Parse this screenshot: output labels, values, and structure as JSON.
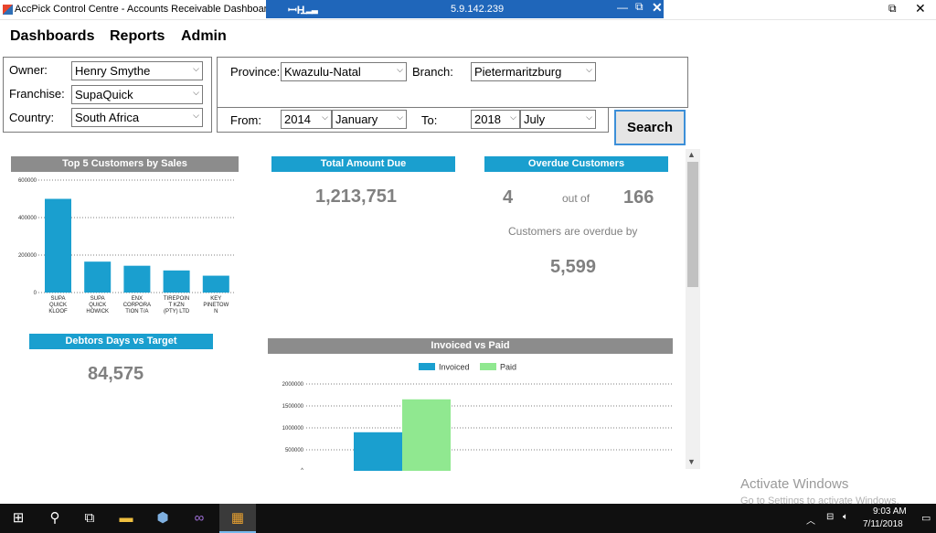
{
  "window": {
    "title": "AccPick Control Centre - Accounts Receivable Dashboard",
    "remote_ip": "5.9.142.239"
  },
  "menu": {
    "dashboards": "Dashboards",
    "reports": "Reports",
    "admin": "Admin"
  },
  "filters": {
    "owner_label": "Owner:",
    "owner_value": "Henry Smythe",
    "franchise_label": "Franchise:",
    "franchise_value": "SupaQuick",
    "country_label": "Country:",
    "country_value": "South Africa",
    "province_label": "Province:",
    "province_value": "Kwazulu-Natal",
    "branch_label": "Branch:",
    "branch_value": "Pietermaritzburg",
    "from_label": "From:",
    "from_year": "2014",
    "from_month": "January",
    "to_label": "To:",
    "to_year": "2018",
    "to_month": "July",
    "search_label": "Search"
  },
  "panels": {
    "top5_title": "Top 5 Customers by Sales",
    "total_due_title": "Total Amount Due",
    "total_due_value": "1,213,751",
    "overdue_title": "Overdue Customers",
    "overdue_count": "4",
    "overdue_out_of": "out of",
    "overdue_total": "166",
    "overdue_by_text": "Customers are overdue by",
    "overdue_by_value": "5,599",
    "debtors_title": "Debtors Days vs Target",
    "debtors_value": "84,575",
    "invoiced_title": "Invoiced vs Paid"
  },
  "chart_data": [
    {
      "type": "bar",
      "title": "Top 5 Customers by Sales",
      "categories": [
        [
          "SUPA",
          "QUICK",
          "KLOOF"
        ],
        [
          "SUPA",
          "QUICK",
          "HOWICK"
        ],
        [
          "ENX",
          "CORPORA",
          "TION T/A"
        ],
        [
          "TIREPOIN",
          "T KZN",
          "(PTY) LTD"
        ],
        [
          "KEY",
          "PINETOW",
          "N"
        ]
      ],
      "values": [
        500000,
        165000,
        143000,
        118000,
        90000
      ],
      "y_ticks": [
        "600000",
        "400000",
        "200000",
        "0"
      ],
      "ylim": [
        0,
        600000
      ],
      "grid": true,
      "color": "#1a9fcf"
    },
    {
      "type": "bar",
      "title": "Invoiced vs Paid",
      "legend": [
        "Invoiced",
        "Paid"
      ],
      "legend_position": "top-center",
      "series": [
        {
          "name": "Invoiced",
          "values": [
            900000,
            0
          ],
          "color": "#1a9fcf"
        },
        {
          "name": "Paid",
          "values": [
            1650000,
            15000
          ],
          "color": "#90e890"
        }
      ],
      "y_ticks": [
        "2000000",
        "1500000",
        "1000000",
        "500000"
      ],
      "ylim": [
        0,
        2000000
      ],
      "grid": true
    }
  ],
  "watermark": {
    "line1": "Activate Windows",
    "line2": "Go to Settings to activate Windows."
  },
  "taskbar": {
    "icons": [
      "windows-start-icon",
      "search-icon",
      "task-view-icon",
      "file-explorer-icon",
      "virtualbox-icon",
      "visual-studio-icon",
      "accpick-app-icon"
    ],
    "clock_time": "9:03 AM",
    "clock_date": "7/11/2018"
  }
}
